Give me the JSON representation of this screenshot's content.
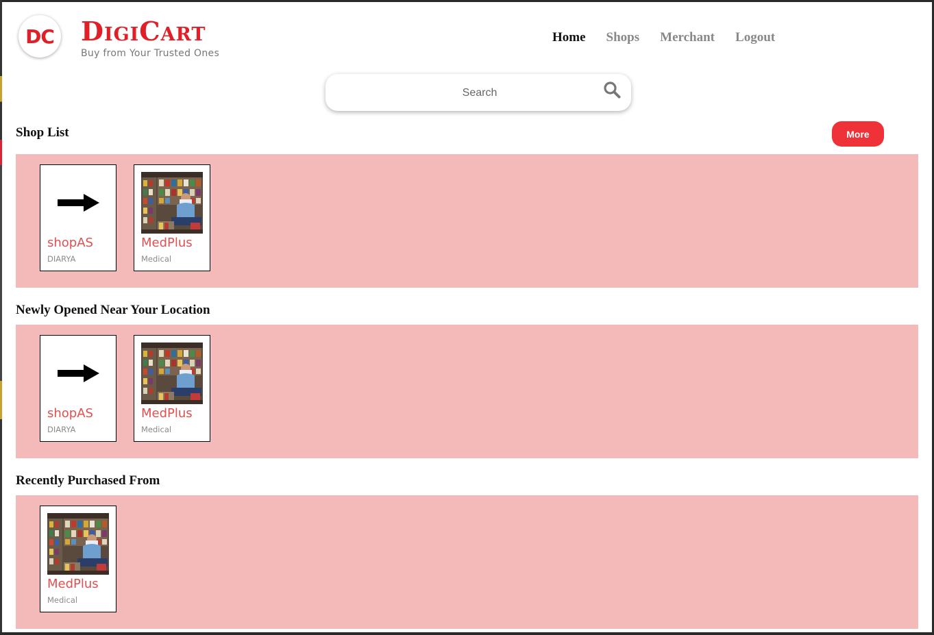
{
  "brand": {
    "logo_initials": "DC",
    "name": "DigiCart",
    "tagline": "Buy from Your Trusted Ones",
    "color": "#e01f26"
  },
  "nav": {
    "items": [
      {
        "label": "Home",
        "active": true
      },
      {
        "label": "Shops",
        "active": false
      },
      {
        "label": "Merchant",
        "active": false
      },
      {
        "label": "Logout",
        "active": false
      }
    ]
  },
  "search": {
    "placeholder": "Search",
    "value": "",
    "icon": "search-icon"
  },
  "sections": {
    "shop_list": {
      "title": "Shop List",
      "more_label": "More",
      "shops": [
        {
          "name": "shopAS",
          "category": "DIARYA",
          "image": "arrow-right-icon"
        },
        {
          "name": "MedPlus",
          "category": "Medical",
          "image": "store-photo"
        }
      ]
    },
    "newly_opened": {
      "title": "Newly Opened Near Your Location",
      "shops": [
        {
          "name": "shopAS",
          "category": "DIARYA",
          "image": "arrow-right-icon"
        },
        {
          "name": "MedPlus",
          "category": "Medical",
          "image": "store-photo"
        }
      ]
    },
    "recently_purchased": {
      "title": "Recently Purchased From",
      "shops": [
        {
          "name": "MedPlus",
          "category": "Medical",
          "image": "store-photo"
        }
      ]
    }
  },
  "colors": {
    "accent": "#ef3237",
    "shelf_background": "#f4b9b9",
    "shop_name": "#e05050"
  }
}
